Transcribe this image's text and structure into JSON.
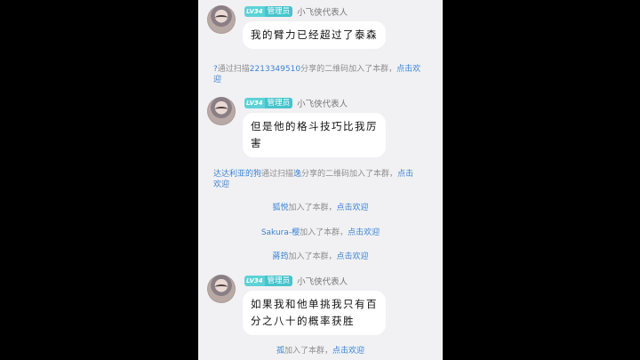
{
  "messages": [
    {
      "level": "LV34",
      "role": "管理员",
      "nickname": "小飞侠代表人",
      "text": "我的臂力已经超过了泰森"
    },
    {
      "level": "LV34",
      "role": "管理员",
      "nickname": "小飞侠代表人",
      "text_line1": "但是他的格斗技巧比我厉",
      "text_line2": "害"
    },
    {
      "level": "LV34",
      "role": "管理员",
      "nickname": "小飞侠代表人",
      "text_line1": "如果我和他单挑我只有百",
      "text_line2": "分之八十的概率获胜"
    }
  ],
  "system": {
    "join1": {
      "name": "?",
      "via": "通过扫描",
      "scanner": "2213349510",
      "suffix": "分享的二维码加入了本群，",
      "action": "点击欢",
      "action_line2": "迎"
    },
    "join2": {
      "name": "达达利亚的狗",
      "via": "通过扫描",
      "scanner": "逸",
      "suffix": "分享的二维码加入了本群，",
      "action": "点击",
      "action_line2": "欢迎"
    },
    "join3": {
      "name": "狐悦",
      "text": "加入了本群，",
      "action": "点击欢迎"
    },
    "join4": {
      "name": "Sakura-樱",
      "text": "加入了本群，",
      "action": "点击欢迎"
    },
    "join5": {
      "name": "蔣筠",
      "text": "加入了本群，",
      "action": "点击欢迎"
    },
    "join6": {
      "name": "孤",
      "text": "加入了本群，",
      "action": "点击欢迎"
    }
  }
}
